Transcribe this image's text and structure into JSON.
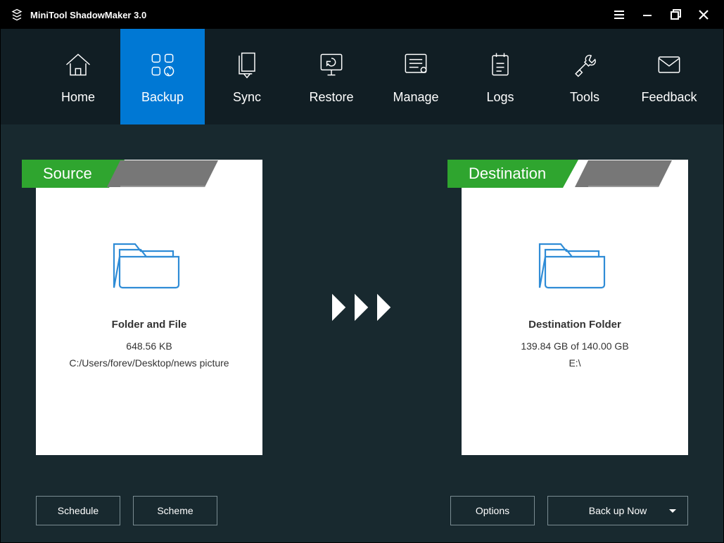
{
  "app": {
    "title": "MiniTool ShadowMaker 3.0"
  },
  "nav": {
    "items": [
      {
        "label": "Home"
      },
      {
        "label": "Backup"
      },
      {
        "label": "Sync"
      },
      {
        "label": "Restore"
      },
      {
        "label": "Manage"
      },
      {
        "label": "Logs"
      },
      {
        "label": "Tools"
      },
      {
        "label": "Feedback"
      }
    ]
  },
  "source": {
    "tab": "Source",
    "title": "Folder and File",
    "size": "648.56 KB",
    "path": "C:/Users/forev/Desktop/news picture"
  },
  "destination": {
    "tab": "Destination",
    "title": "Destination Folder",
    "size": "139.84 GB of 140.00 GB",
    "path": "E:\\"
  },
  "footer": {
    "schedule": "Schedule",
    "scheme": "Scheme",
    "options": "Options",
    "backup_now": "Back up Now"
  }
}
